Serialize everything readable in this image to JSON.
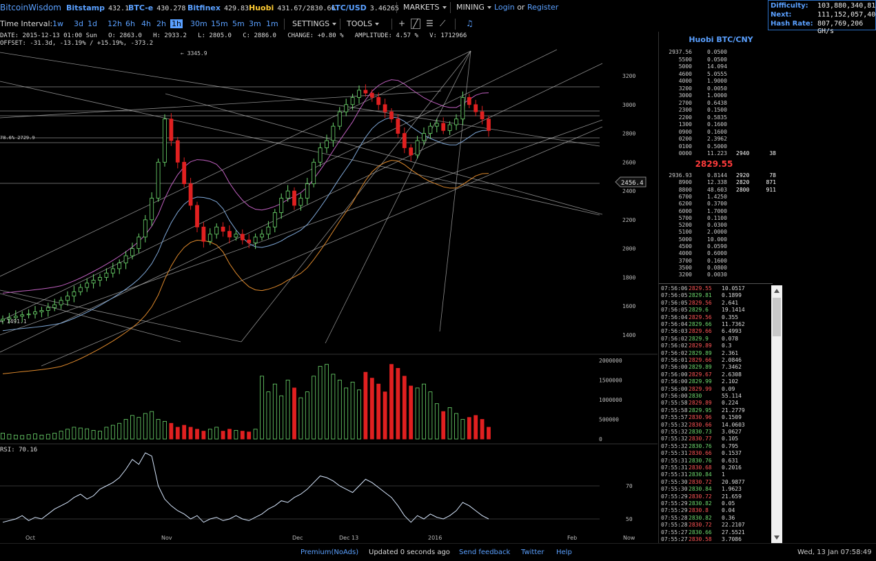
{
  "topbar": {
    "logo": "BitcoinWisdom",
    "exchanges": [
      {
        "name": "Bitstamp",
        "value": "432.1"
      },
      {
        "name": "BTC-e",
        "value": "430.278"
      },
      {
        "name": "Bitfinex",
        "value": "429.83"
      },
      {
        "name": "Huobi",
        "value": "431.67/2830.66"
      },
      {
        "name": "LTC/USD",
        "value": "3.46265"
      }
    ],
    "markets_label": "MARKETS",
    "mining_label": "MINING",
    "login_label": "Login",
    "or_label": "or",
    "register_label": "Register"
  },
  "mining_stats": {
    "difficulty_label": "Difficulty:",
    "difficulty_value": "103,880,340,815",
    "next_label": "Next:",
    "next_value": "111,152,057,404",
    "hashrate_label": "Hash Rate:",
    "hashrate_value": "807,769,206 GH/s"
  },
  "toolbar": {
    "interval_label": "Time Interval:",
    "intervals": [
      "1w",
      "3d",
      "1d",
      "12h",
      "6h",
      "4h",
      "2h",
      "1h",
      "30m",
      "15m",
      "5m",
      "3m",
      "1m"
    ],
    "selected_interval": "1h",
    "settings_label": "SETTINGS",
    "tools_label": "TOOLS"
  },
  "ohlc": {
    "line1": "DATE: 2015-12-13 01:00 Sun   O: 2863.0   H: 2933.2   L: 2805.0   C: 2886.0   CHANGE: +0.80 %   AMPLITUDE: 4.57 %   V: 1712966",
    "line2": "OFFSET: -31.3d, -13.19% / +15.19%, -373.2"
  },
  "chart_labels": {
    "high_marker": "← 3345.9",
    "fib_label": "78.6% 2729.9",
    "low_marker": "→ 1491.1",
    "cursor_price": "2456.4",
    "rsi_label": "RSI: 70.16"
  },
  "chart_data": {
    "type": "candlestick",
    "price_ticks": [
      "3200",
      "3000",
      "2800",
      "2600",
      "2400",
      "2200",
      "2000",
      "1800",
      "1600",
      "1400"
    ],
    "volume_ticks": [
      "2000000",
      "1500000",
      "1000000",
      "500000",
      "0"
    ],
    "rsi_ticks": [
      "70",
      "50"
    ],
    "x_ticks": [
      "Oct",
      "Nov",
      "Dec",
      "Dec 13",
      "2016",
      "Feb",
      "Now"
    ],
    "price_range": [
      1300,
      3400
    ],
    "volume_range": [
      0,
      2000000
    ],
    "close": [
      1510,
      1520,
      1530,
      1540,
      1545,
      1560,
      1570,
      1590,
      1610,
      1640,
      1670,
      1700,
      1730,
      1760,
      1780,
      1800,
      1830,
      1860,
      1900,
      1950,
      2000,
      2080,
      2200,
      2350,
      2600,
      2900,
      2750,
      2600,
      2450,
      2300,
      2150,
      2050,
      2100,
      2150,
      2120,
      2080,
      2100,
      2060,
      2040,
      2080,
      2100,
      2150,
      2250,
      2350,
      2400,
      2300,
      2350,
      2450,
      2600,
      2700,
      2750,
      2850,
      2950,
      3000,
      3050,
      3100,
      3080,
      3050,
      3000,
      2950,
      2900,
      2800,
      2700,
      2650,
      2750,
      2800,
      2850,
      2870,
      2820,
      2860,
      2900,
      3050,
      3000,
      2950,
      2900,
      2820
    ],
    "volume": [
      150000,
      120000,
      100000,
      90000,
      110000,
      130000,
      100000,
      120000,
      150000,
      200000,
      250000,
      300000,
      280000,
      260000,
      220000,
      200000,
      300000,
      350000,
      400000,
      500000,
      600000,
      550000,
      650000,
      700000,
      500000,
      450000,
      400000,
      300000,
      350000,
      300000,
      250000,
      200000,
      250000,
      300000,
      200000,
      250000,
      220000,
      200000,
      180000,
      250000,
      1600000,
      1200000,
      1400000,
      1100000,
      1500000,
      1300000,
      1050000,
      1200000,
      1600000,
      1850000,
      1900000,
      1650000,
      1500000,
      1300000,
      1450000,
      1250000,
      1700000,
      1550000,
      1400000,
      1200000,
      1900000,
      1800000,
      1600000,
      1350000,
      1300000,
      1400000,
      1200000,
      900000,
      700000,
      800000,
      650000,
      500000,
      550000,
      600000,
      500000,
      300000
    ],
    "rsi": [
      48,
      49,
      50,
      52,
      49,
      51,
      50,
      53,
      56,
      58,
      60,
      63,
      65,
      62,
      64,
      68,
      70,
      72,
      75,
      80,
      86,
      83,
      90,
      88,
      70,
      62,
      58,
      55,
      53,
      50,
      52,
      48,
      50,
      51,
      49,
      50,
      52,
      50,
      49,
      51,
      53,
      56,
      58,
      61,
      60,
      63,
      65,
      68,
      72,
      76,
      75,
      73,
      70,
      68,
      66,
      70,
      74,
      72,
      69,
      66,
      63,
      58,
      52,
      48,
      52,
      50,
      53,
      51,
      50,
      52,
      55,
      60,
      58,
      55,
      52,
      50
    ]
  },
  "orderbook": {
    "title": "Huobi BTC/CNY",
    "asks": [
      [
        "2937.56",
        "0.0500"
      ],
      [
        "5500",
        "0.0500"
      ],
      [
        "5000",
        "14.094"
      ],
      [
        "4600",
        "5.0555"
      ],
      [
        "4000",
        "1.9000"
      ],
      [
        "3200",
        "0.0050"
      ],
      [
        "3000",
        "1.0000"
      ],
      [
        "2700",
        "0.6438"
      ],
      [
        "2300",
        "0.1500"
      ],
      [
        "2200",
        "0.5835"
      ],
      [
        "1300",
        "0.1600"
      ],
      [
        "0900",
        "0.1600"
      ],
      [
        "0200",
        "2.3962"
      ],
      [
        "0100",
        "0.5000"
      ],
      [
        "0000",
        "11.223"
      ]
    ],
    "ask_totals": [
      [
        "2940",
        "38"
      ]
    ],
    "last_price": "2829.55",
    "bids": [
      [
        "2936.93",
        "0.8144"
      ],
      [
        "8900",
        "12.338"
      ],
      [
        "8800",
        "48.603"
      ],
      [
        "6700",
        "1.4250"
      ],
      [
        "6200",
        "0.3700"
      ],
      [
        "6000",
        "1.7000"
      ],
      [
        "5700",
        "0.1100"
      ],
      [
        "5200",
        "0.0300"
      ],
      [
        "5100",
        "2.0000"
      ],
      [
        "5000",
        "10.000"
      ],
      [
        "4500",
        "0.0590"
      ],
      [
        "4000",
        "0.6000"
      ],
      [
        "3700",
        "0.1600"
      ],
      [
        "3500",
        "0.0800"
      ],
      [
        "3200",
        "0.0030"
      ]
    ],
    "bid_totals": [
      [
        "2920",
        "78"
      ],
      [
        "2820",
        "871"
      ],
      [
        "2800",
        "911"
      ]
    ]
  },
  "trades": [
    [
      "07:56:06",
      "2829.55",
      "dn",
      "10.0517"
    ],
    [
      "07:56:05",
      "2829.81",
      "up",
      "0.1899"
    ],
    [
      "07:56:05",
      "2829.56",
      "dn",
      "2.641"
    ],
    [
      "07:56:05",
      "2829.6",
      "up",
      "19.1414"
    ],
    [
      "07:56:04",
      "2829.56",
      "dn",
      "0.355"
    ],
    [
      "07:56:04",
      "2829.66",
      "up",
      "11.7362"
    ],
    [
      "07:56:03",
      "2829.66",
      "dn",
      "6.4993"
    ],
    [
      "07:56:02",
      "2829.9",
      "up",
      "0.078"
    ],
    [
      "07:56:02",
      "2829.89",
      "dn",
      "0.3"
    ],
    [
      "07:56:02",
      "2829.89",
      "up",
      "2.361"
    ],
    [
      "07:56:01",
      "2829.66",
      "dn",
      "2.0846"
    ],
    [
      "07:56:00",
      "2829.89",
      "up",
      "7.3462"
    ],
    [
      "07:56:00",
      "2829.67",
      "dn",
      "2.6308"
    ],
    [
      "07:56:00",
      "2829.99",
      "up",
      "2.102"
    ],
    [
      "07:56:00",
      "2829.99",
      "dn",
      "0.09"
    ],
    [
      "07:56:00",
      "2830",
      "up",
      "55.114"
    ],
    [
      "07:55:58",
      "2829.89",
      "dn",
      "0.224"
    ],
    [
      "07:55:58",
      "2829.95",
      "up",
      "21.2779"
    ],
    [
      "07:55:57",
      "2830.96",
      "dn",
      "0.1509"
    ],
    [
      "07:55:32",
      "2830.66",
      "dn",
      "14.0603"
    ],
    [
      "07:55:32",
      "2830.73",
      "up",
      "3.0627"
    ],
    [
      "07:55:32",
      "2830.77",
      "dn",
      "0.105"
    ],
    [
      "07:55:32",
      "2830.76",
      "up",
      "0.795"
    ],
    [
      "07:55:31",
      "2830.66",
      "dn",
      "0.1537"
    ],
    [
      "07:55:31",
      "2830.76",
      "up",
      "0.631"
    ],
    [
      "07:55:31",
      "2830.68",
      "dn",
      "0.2016"
    ],
    [
      "07:55:31",
      "2830.84",
      "up",
      "1"
    ],
    [
      "07:55:30",
      "2830.72",
      "dn",
      "20.9877"
    ],
    [
      "07:55:30",
      "2830.84",
      "up",
      "1.9623"
    ],
    [
      "07:55:29",
      "2830.72",
      "dn",
      "21.659"
    ],
    [
      "07:55:29",
      "2830.82",
      "up",
      "0.05"
    ],
    [
      "07:55:29",
      "2830.8",
      "dn",
      "0.04"
    ],
    [
      "07:55:28",
      "2830.82",
      "up",
      "0.36"
    ],
    [
      "07:55:28",
      "2830.72",
      "dn",
      "22.2107"
    ],
    [
      "07:55:27",
      "2830.66",
      "up",
      "27.5521"
    ],
    [
      "07:55:27",
      "2830.58",
      "dn",
      "3.7086"
    ]
  ],
  "footer": {
    "premium": "Premium(NoAds)",
    "updated": "Updated 0 seconds ago",
    "feedback": "Send feedback",
    "twitter": "Twitter",
    "help": "Help",
    "datetime": "Wed, 13 Jan 07:58:49"
  },
  "colors": {
    "up": "#6fdc6f",
    "down": "#e02020",
    "accent": "#5aa0ff",
    "bollinger": "#c060c0",
    "ma": "#e08a2c"
  }
}
